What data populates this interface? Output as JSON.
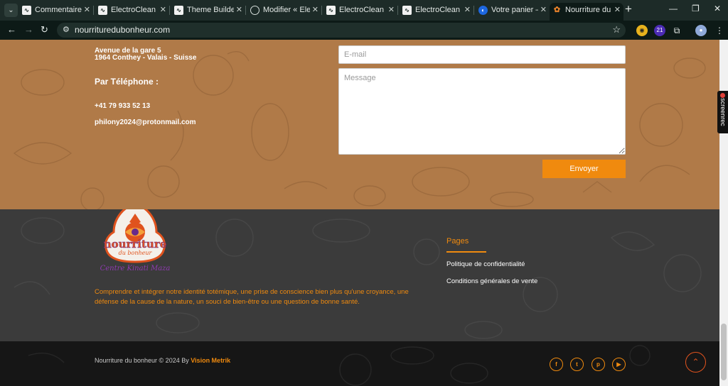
{
  "browser": {
    "tabs": [
      {
        "label": "Commentaires ‹",
        "icon": "wp-admin-icon"
      },
      {
        "label": "ElectroClean Ma",
        "icon": "wp-admin-icon"
      },
      {
        "label": "Theme Builder ‹",
        "icon": "wp-admin-icon"
      },
      {
        "label": "Modifier « Electr",
        "icon": "globe-icon"
      },
      {
        "label": "ElectroClean Ma",
        "icon": "wp-admin-icon"
      },
      {
        "label": "ElectroClean Ma",
        "icon": "wp-admin-icon"
      },
      {
        "label": "Votre panier – el",
        "icon": "cart-site-icon"
      },
      {
        "label": "Nourriture du bo",
        "icon": "site-favicon"
      }
    ],
    "active_tab_index": 7,
    "url": "nourrituredubonheur.com",
    "extension_badge": "21"
  },
  "contact": {
    "address_line1": "Avenue de la gare 5",
    "address_line2": "1964 Conthey - Valais - Suisse",
    "phone_title": "Par Téléphone :",
    "phone": "+41 79 933 52 13",
    "email": "philony2024@protonmail.com",
    "form": {
      "email_placeholder": "E-mail",
      "message_placeholder": "Message",
      "submit_label": "Envoyer"
    }
  },
  "footer": {
    "logo_text_main": "nourriture",
    "logo_text_sub": "du bonheur",
    "logo_script": "Centre Kinati Maza",
    "tagline": "Comprendre et intégrer notre identité totémique, une prise de conscience bien plus qu'une croyance, une défense de la cause de la nature, un souci de bien-être ou une question de bonne santé.",
    "pages_title": "Pages",
    "pages_links": [
      "Politique de confidentialité",
      "Conditions générales de vente"
    ],
    "copyright_prefix": "Nourriture du bonheur © 2024 By ",
    "copyright_brand": "Vision Metrik",
    "social": [
      {
        "name": "facebook",
        "glyph": "f"
      },
      {
        "name": "twitter",
        "glyph": "t"
      },
      {
        "name": "pinterest",
        "glyph": "p"
      },
      {
        "name": "youtube",
        "glyph": "▶"
      }
    ],
    "to_top_glyph": "⌃"
  },
  "colors": {
    "contact_bg": "#b07a48",
    "footer_bg": "#3b3b3b",
    "bottom_bg": "#161616",
    "accent": "#f08a0e"
  },
  "screenrec_label": "screenrec"
}
